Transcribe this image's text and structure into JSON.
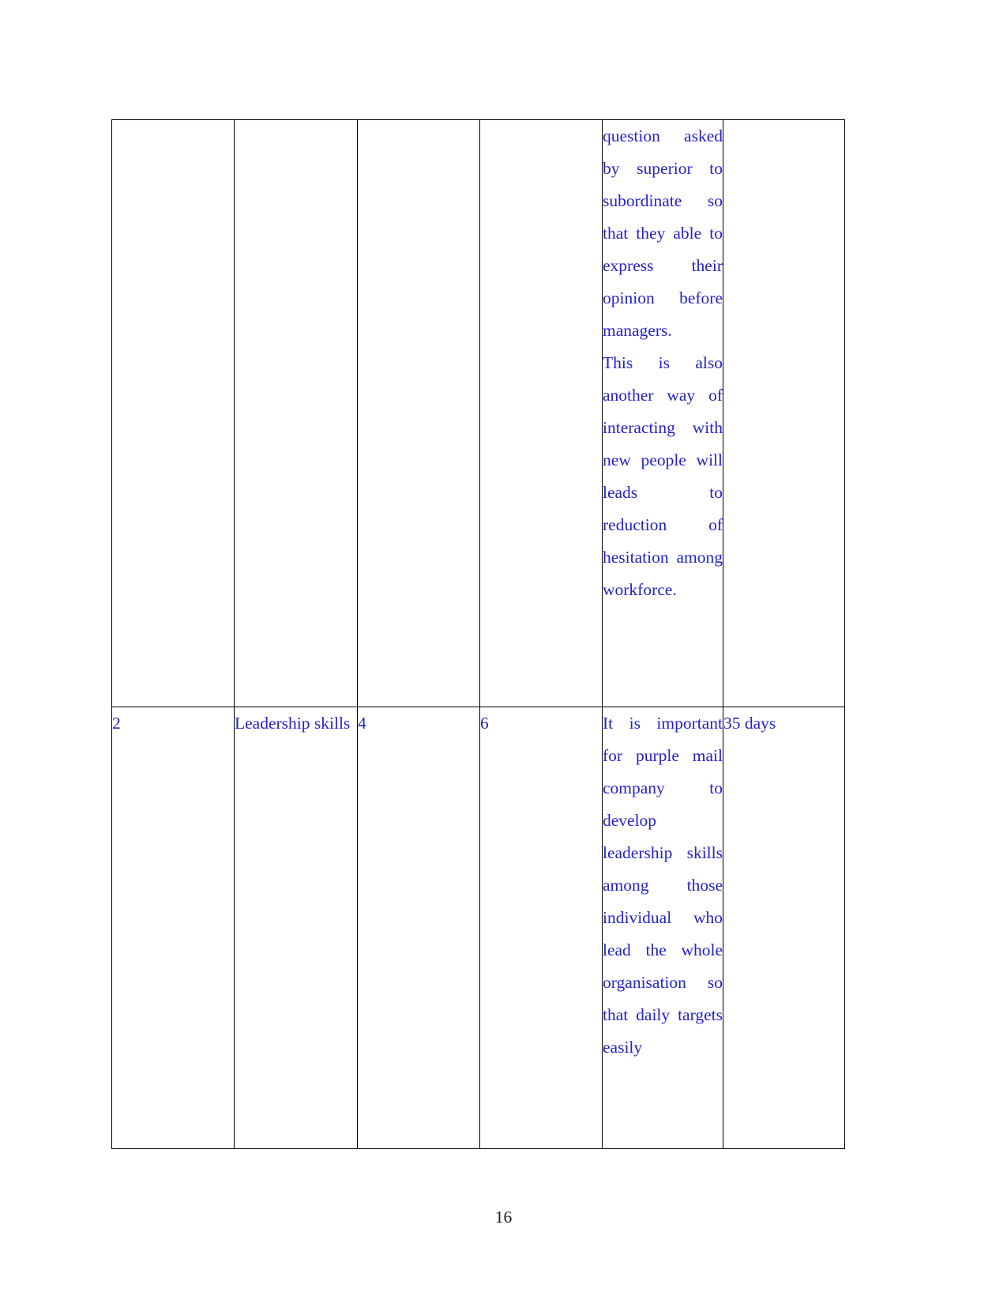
{
  "document": {
    "page_number": "16",
    "text_color": "#2222CC",
    "border_color": "#000000",
    "page_number_color": "#1A1A1A"
  },
  "table": {
    "column_count": 6,
    "rows": [
      {
        "id": "row-continued",
        "serial": "",
        "skill": "",
        "current_level": "",
        "target_level": "",
        "development_description_paragraphs": [
          "question asked by superior to subordinate so that they able to express their opinion before managers.",
          "This is also another way of interacting with new people will leads to reduction of hesitation among workforce."
        ],
        "timeframe": ""
      },
      {
        "id": "row-2",
        "serial": "2",
        "skill": "Leadership skills",
        "current_level": "4",
        "target_level": "6",
        "development_description_paragraphs": [
          "It is important for purple mail company to develop leadership skills among those individual who lead the whole organisation so that daily targets easily"
        ],
        "timeframe": "35 days"
      }
    ]
  }
}
